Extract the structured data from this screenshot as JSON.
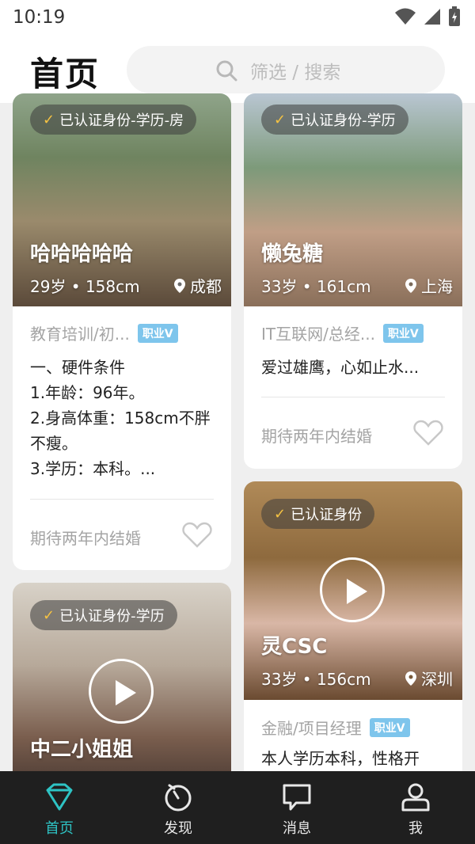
{
  "status_bar": {
    "time": "10:19"
  },
  "header": {
    "title": "首页",
    "search_placeholder": "筛选 / 搜索"
  },
  "cards": [
    {
      "verified": "已认证身份-学历-房",
      "name": "哈哈哈哈哈",
      "age_height": "29岁 • 158cm",
      "city": "成都",
      "job": "教育培训/初...",
      "job_badge": "职业V",
      "description": "一、硬件条件\n1.年龄：96年。\n2.身高体重：158cm不胖不瘦。\n3.学历：本科。...",
      "hope": "期待两年内结婚"
    },
    {
      "verified": "已认证身份-学历",
      "name": "懒兔糖",
      "age_height": "33岁 • 161cm",
      "city": "上海",
      "job": "IT互联网/总经...",
      "job_badge": "职业V",
      "description": "爱过雄鹰，心如止水...",
      "hope": "期待两年内结婚"
    },
    {
      "verified": "已认证身份-学历",
      "name": "中二小姐姐"
    },
    {
      "verified": "已认证身份",
      "name": "灵CSC",
      "age_height": "33岁 • 156cm",
      "city": "深圳",
      "job": "金融/项目经理",
      "job_badge": "职业V",
      "description": "本人学历本科，性格开"
    }
  ],
  "tabbar": {
    "items": [
      {
        "label": "首页",
        "icon": "diamond-icon",
        "active": true
      },
      {
        "label": "发现",
        "icon": "discover-icon"
      },
      {
        "label": "消息",
        "icon": "message-icon"
      },
      {
        "label": "我",
        "icon": "profile-icon"
      }
    ],
    "active_color": "#2ec3c4"
  }
}
